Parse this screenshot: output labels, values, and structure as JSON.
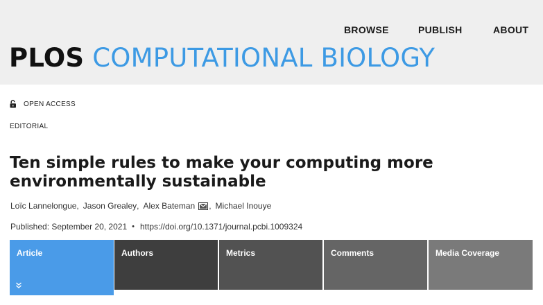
{
  "nav": {
    "browse": "BROWSE",
    "publish": "PUBLISH",
    "about": "ABOUT"
  },
  "brand": {
    "plos": "PLOS",
    "journal": "COMPUTATIONAL BIOLOGY",
    "accent_color": "#3d9ae4"
  },
  "meta": {
    "access_icon": "open-lock-icon",
    "access_label": "OPEN ACCESS",
    "article_type": "EDITORIAL"
  },
  "article": {
    "title": "Ten simple rules to make your computing more environmentally sustainable",
    "authors": [
      {
        "name": "Loïc Lannelongue"
      },
      {
        "name": "Jason Grealey"
      },
      {
        "name": "Alex Bateman",
        "icon": "mail-icon"
      },
      {
        "name": "Michael Inouye"
      }
    ],
    "published": "Published: September 20, 2021",
    "bullet": "•",
    "doi": "https://doi.org/10.1371/journal.pcbi.1009324"
  },
  "tabs": [
    {
      "label": "Article",
      "active": true,
      "color": "#4a9be8"
    },
    {
      "label": "Authors",
      "color": "#3e3e3e"
    },
    {
      "label": "Metrics",
      "color": "#525252"
    },
    {
      "label": "Comments",
      "color": "#656565"
    },
    {
      "label": "Media Coverage",
      "color": "#7a7a7a"
    }
  ]
}
